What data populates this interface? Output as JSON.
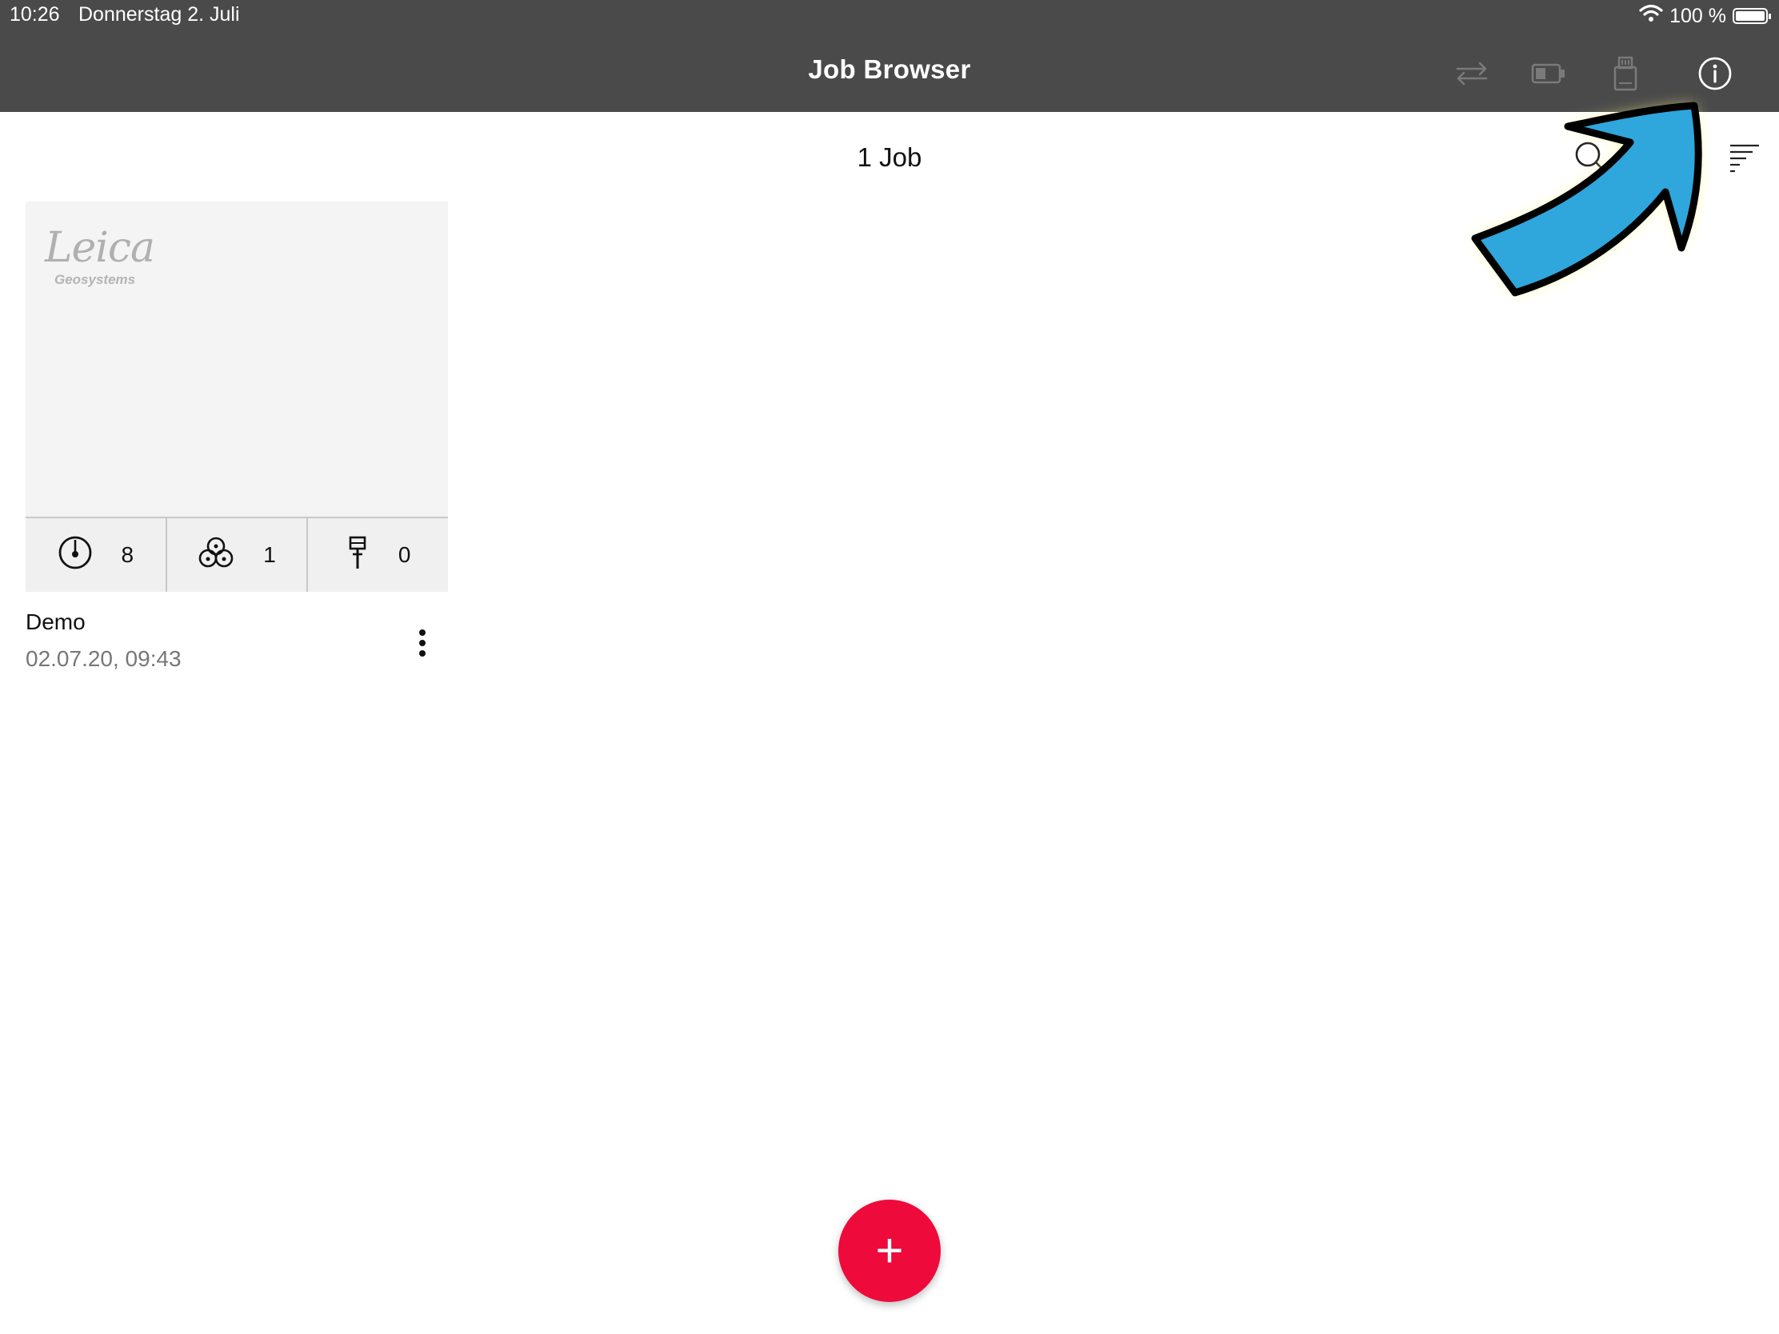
{
  "status_bar": {
    "time": "10:26",
    "date": "Donnerstag 2. Juli",
    "battery_text": "100 %"
  },
  "toolbar": {
    "title": "Job Browser",
    "icons": [
      "sync-icon",
      "battery-device-icon",
      "sd-card-icon",
      "info-icon"
    ]
  },
  "job_list": {
    "count_label": "1 Job",
    "icons": [
      "search-icon",
      "sort-icon"
    ]
  },
  "job_card": {
    "logo_text": "Leica",
    "logo_subtext": "Geosystems",
    "stats": [
      {
        "icon": "scan-station-icon",
        "value": "8"
      },
      {
        "icon": "cluster-icon",
        "value": "1"
      },
      {
        "icon": "pin-icon",
        "value": "0"
      }
    ],
    "name": "Demo",
    "date": "02.07.20, 09:43"
  },
  "fab": {
    "label": "+"
  },
  "colors": {
    "toolbar_bg": "#4a4a4a",
    "fab_red": "#ee0a3a",
    "annotation_blue": "#2fa6dc"
  }
}
